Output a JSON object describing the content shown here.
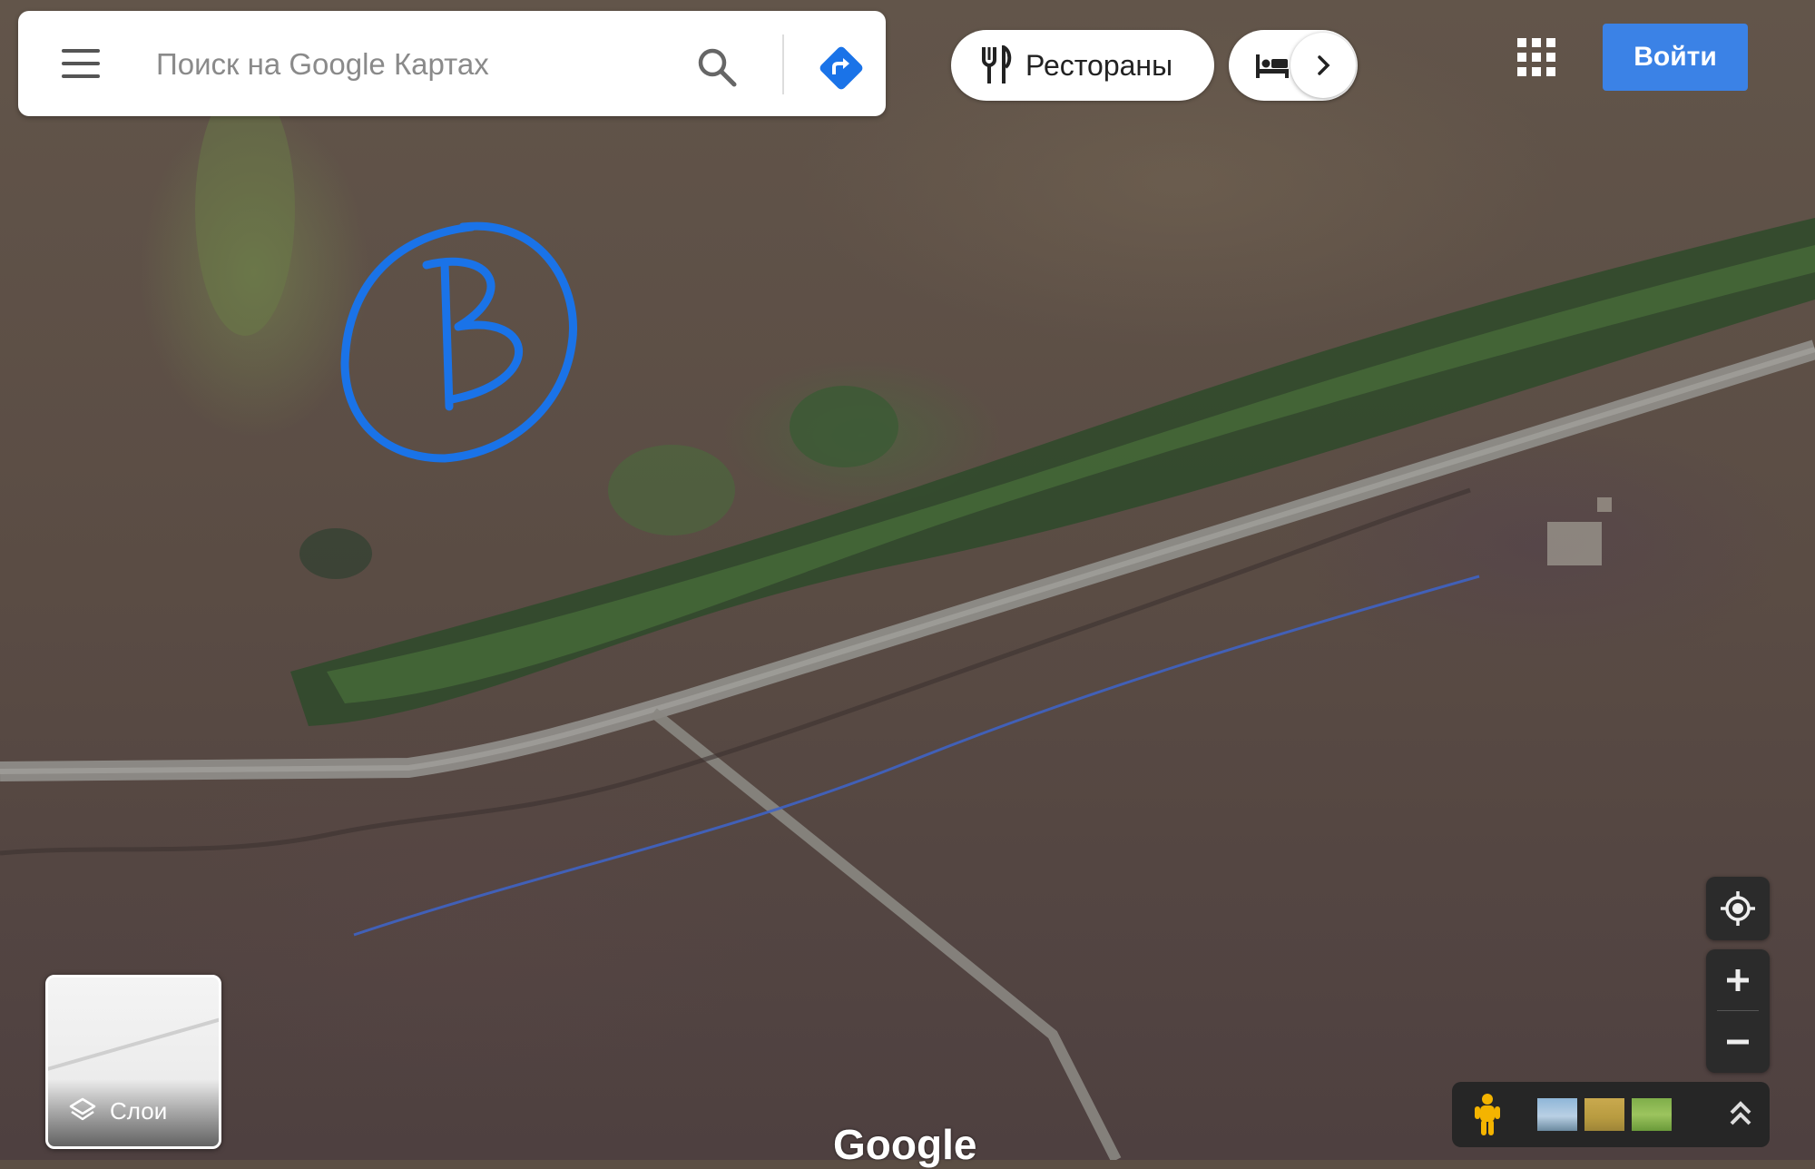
{
  "search": {
    "placeholder": "Поиск на Google Картах"
  },
  "chips": {
    "restaurants_label": "Рестораны"
  },
  "header": {
    "signin_label": "Войти"
  },
  "layers": {
    "label": "Слои"
  },
  "map": {
    "type": "satellite",
    "annotation_letter": "B",
    "annotation_color": "#1a73e8",
    "water_line_color": "#3f63c4",
    "road_color": "#8e8c88"
  },
  "logo": {
    "text": "Google"
  },
  "colors": {
    "signin_button": "#3b82e6",
    "directions_icon": "#1a73e8",
    "controls_bg": "#2b2b2b"
  }
}
